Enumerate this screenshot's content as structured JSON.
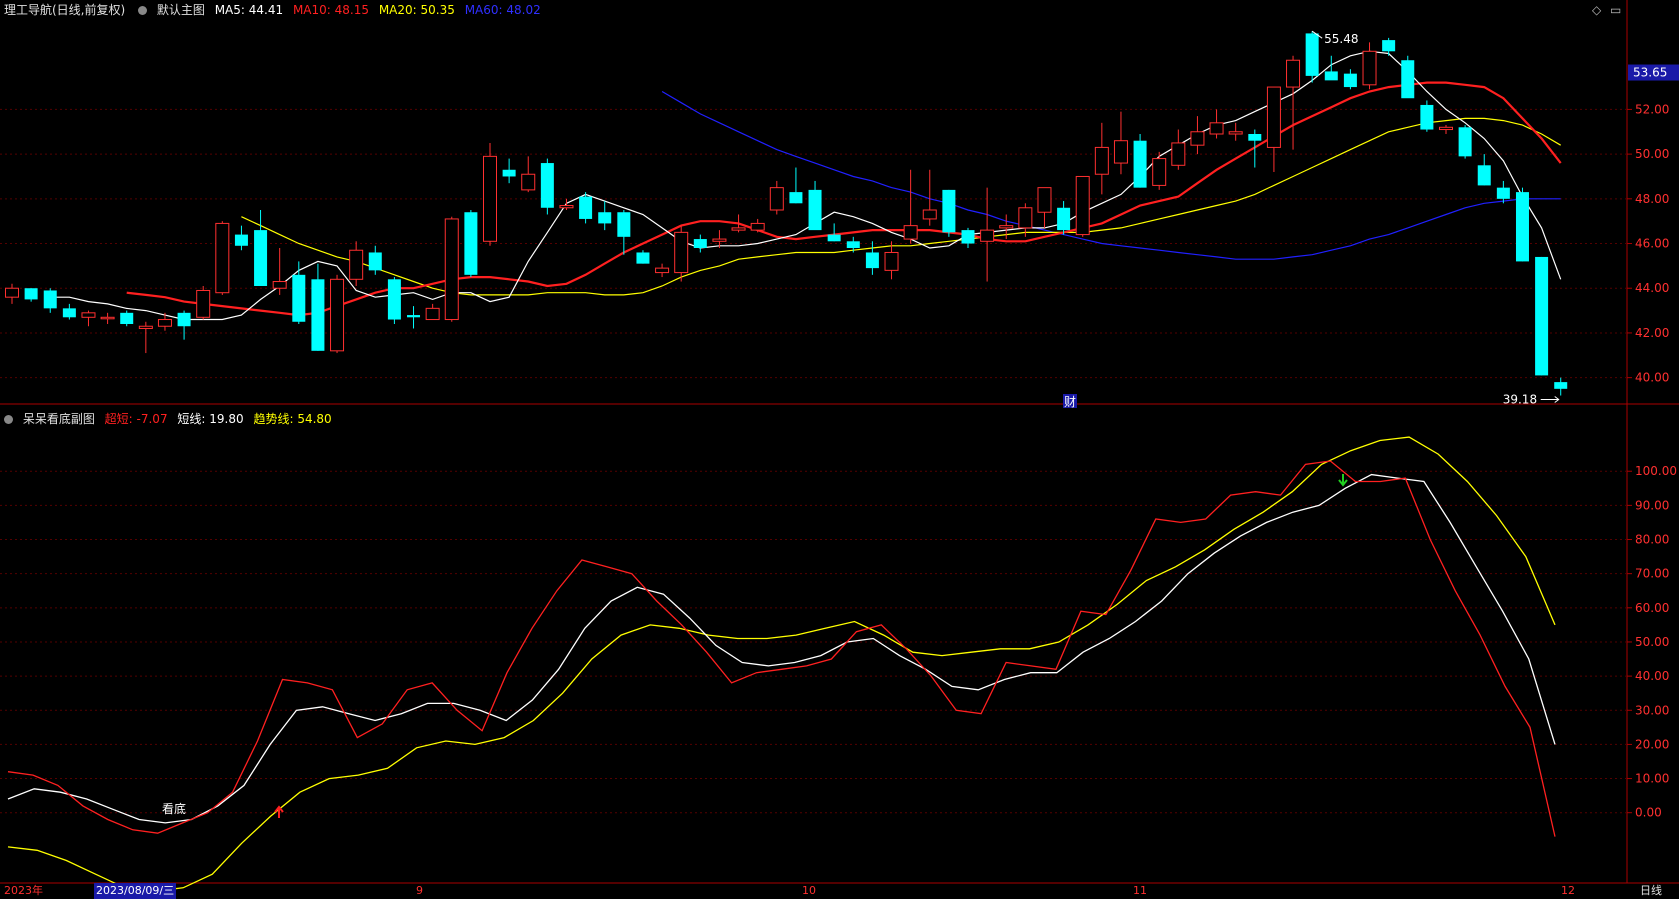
{
  "main_panel": {
    "title": "理工导航(日线,前复权)",
    "selector_label": "默认主图",
    "ma_labels": [
      {
        "text": "MA5: 44.41",
        "color": "#ffffff"
      },
      {
        "text": "MA10: 48.15",
        "color": "#ff2020"
      },
      {
        "text": "MA20: 50.35",
        "color": "#ffff00"
      },
      {
        "text": "MA60: 48.02",
        "color": "#2020ff"
      }
    ],
    "price_ticks": [
      "52.00",
      "50.00",
      "48.00",
      "46.00",
      "44.00",
      "42.00",
      "40.00"
    ],
    "current_price": "53.65",
    "high_marker": "55.48",
    "low_marker": "39.18",
    "finance_marker": "财"
  },
  "sub_panel": {
    "title": "呆呆看底副图",
    "labels": [
      {
        "text": "超短: -7.07",
        "color": "#ff2020"
      },
      {
        "text": "短线: 19.80",
        "color": "#ffffff"
      },
      {
        "text": "趋势线: 54.80",
        "color": "#ffff00"
      }
    ],
    "ticks": [
      "100.00",
      "90.00",
      "80.00",
      "70.00",
      "60.00",
      "50.00",
      "40.00",
      "30.00",
      "20.00",
      "10.00",
      "0.00"
    ],
    "bottom_signal_label": "看底"
  },
  "time_axis": {
    "labels": [
      "2023年",
      "9",
      "10",
      "11",
      "12"
    ],
    "cursor_date": "2023/08/09/三",
    "period_label": "日线"
  },
  "colors": {
    "up": "#ff3030",
    "down": "#00ffff",
    "ma5": "#ffffff",
    "ma10": "#ff2020",
    "ma20": "#ffff00",
    "ma60": "#2020ff",
    "grid": "#550000",
    "frame": "#aa0000"
  },
  "chart_data": [
    {
      "type": "candlestick",
      "title": "理工导航(日线,前复权)",
      "ylim": [
        39,
        56
      ],
      "ohlc": [
        [
          43.6,
          44.2,
          43.3,
          44.0
        ],
        [
          44.0,
          44.0,
          43.4,
          43.5
        ],
        [
          43.9,
          44.0,
          42.9,
          43.1
        ],
        [
          43.1,
          43.3,
          42.6,
          42.7
        ],
        [
          42.7,
          43.0,
          42.3,
          42.9
        ],
        [
          42.7,
          42.9,
          42.4,
          42.7
        ],
        [
          42.9,
          43.0,
          42.3,
          42.4
        ],
        [
          42.2,
          42.5,
          41.1,
          42.3
        ],
        [
          42.3,
          42.9,
          42.1,
          42.6
        ],
        [
          42.9,
          43.0,
          41.7,
          42.3
        ],
        [
          42.7,
          44.1,
          42.6,
          43.9
        ],
        [
          43.8,
          47.0,
          43.7,
          46.9
        ],
        [
          46.4,
          46.8,
          45.7,
          45.9
        ],
        [
          46.6,
          47.5,
          44.1,
          44.1
        ],
        [
          44.0,
          45.8,
          43.7,
          44.3
        ],
        [
          44.6,
          45.2,
          42.4,
          42.5
        ],
        [
          44.4,
          45.1,
          41.2,
          41.2
        ],
        [
          41.2,
          44.6,
          41.1,
          44.4
        ],
        [
          44.4,
          46.1,
          44.1,
          45.7
        ],
        [
          45.6,
          45.9,
          44.6,
          44.8
        ],
        [
          44.4,
          44.5,
          42.4,
          42.6
        ],
        [
          42.8,
          43.2,
          42.2,
          42.7
        ],
        [
          42.6,
          43.3,
          42.6,
          43.1
        ],
        [
          42.6,
          47.2,
          42.5,
          47.1
        ],
        [
          47.4,
          47.5,
          44.5,
          44.6
        ],
        [
          46.1,
          50.5,
          45.9,
          49.9
        ],
        [
          49.3,
          49.8,
          48.7,
          49.0
        ],
        [
          48.4,
          49.9,
          48.3,
          49.1
        ],
        [
          49.6,
          49.8,
          47.3,
          47.6
        ],
        [
          47.6,
          48.0,
          47.5,
          47.7
        ],
        [
          48.1,
          48.3,
          46.9,
          47.1
        ],
        [
          47.4,
          47.9,
          46.6,
          46.9
        ],
        [
          47.4,
          47.5,
          45.5,
          46.3
        ],
        [
          45.6,
          45.7,
          45.1,
          45.1
        ],
        [
          44.7,
          45.1,
          44.5,
          44.9
        ],
        [
          44.7,
          46.8,
          44.3,
          46.5
        ],
        [
          46.2,
          46.4,
          45.6,
          45.8
        ],
        [
          46.1,
          46.6,
          45.8,
          46.2
        ],
        [
          46.6,
          47.3,
          46.5,
          46.7
        ],
        [
          46.6,
          47.1,
          46.5,
          46.9
        ],
        [
          47.5,
          48.8,
          47.3,
          48.5
        ],
        [
          48.3,
          49.4,
          47.8,
          47.8
        ],
        [
          48.4,
          48.8,
          46.9,
          46.6
        ],
        [
          46.4,
          46.9,
          46.1,
          46.1
        ],
        [
          46.1,
          46.3,
          45.6,
          45.8
        ],
        [
          45.6,
          46.1,
          44.6,
          44.9
        ],
        [
          44.8,
          46.1,
          44.4,
          45.6
        ],
        [
          46.2,
          49.3,
          46.0,
          46.8
        ],
        [
          47.1,
          49.3,
          46.8,
          47.5
        ],
        [
          48.4,
          48.4,
          46.3,
          46.5
        ],
        [
          46.6,
          46.7,
          45.8,
          46.0
        ],
        [
          46.1,
          48.5,
          44.3,
          46.6
        ],
        [
          46.7,
          47.3,
          46.2,
          46.8
        ],
        [
          46.7,
          47.8,
          46.3,
          47.6
        ],
        [
          47.4,
          48.5,
          46.7,
          48.5
        ],
        [
          47.6,
          47.9,
          46.4,
          46.6
        ],
        [
          46.4,
          48.9,
          46.3,
          49.0
        ],
        [
          49.1,
          51.4,
          48.2,
          50.3
        ],
        [
          49.6,
          51.9,
          49.1,
          50.6
        ],
        [
          50.6,
          50.9,
          48.5,
          48.5
        ],
        [
          48.6,
          50.1,
          48.4,
          49.8
        ],
        [
          49.5,
          51.1,
          49.3,
          50.5
        ],
        [
          50.4,
          51.7,
          50.0,
          51.0
        ],
        [
          50.9,
          52.0,
          50.7,
          51.4
        ],
        [
          50.9,
          51.4,
          50.6,
          51.0
        ],
        [
          50.9,
          51.1,
          49.4,
          50.6
        ],
        [
          50.3,
          51.8,
          49.2,
          53.0
        ],
        [
          53.0,
          54.4,
          50.2,
          54.2
        ],
        [
          55.4,
          55.5,
          53.2,
          53.5
        ],
        [
          53.7,
          54.4,
          53.4,
          53.3
        ],
        [
          53.6,
          53.8,
          52.9,
          53.0
        ],
        [
          53.1,
          55.0,
          52.9,
          54.6
        ],
        [
          55.1,
          55.2,
          54.4,
          54.6
        ],
        [
          54.2,
          54.4,
          52.6,
          52.5
        ],
        [
          52.2,
          52.4,
          51.0,
          51.1
        ],
        [
          51.1,
          51.3,
          50.9,
          51.2
        ],
        [
          51.2,
          51.3,
          49.8,
          49.9
        ],
        [
          49.5,
          50.0,
          48.6,
          48.6
        ],
        [
          48.5,
          48.8,
          47.8,
          48.0
        ],
        [
          48.3,
          48.5,
          45.2,
          45.2
        ],
        [
          45.4,
          45.4,
          40.1,
          40.1
        ],
        [
          39.8,
          40.0,
          39.2,
          39.5
        ]
      ],
      "ma5": [
        43.6,
        43.6,
        43.4,
        43.3,
        43.1,
        43.0,
        42.8,
        42.6,
        42.6,
        42.6,
        42.8,
        43.5,
        44.1,
        44.8,
        45.2,
        45.0,
        43.9,
        43.6,
        43.7,
        43.8,
        43.5,
        43.8,
        43.8,
        43.4,
        43.6,
        45.2,
        46.5,
        47.8,
        48.2,
        47.9,
        47.6,
        47.3,
        46.7,
        46.1,
        45.8,
        45.9,
        45.9,
        46.0,
        46.2,
        46.4,
        46.9,
        47.4,
        47.2,
        46.9,
        46.5,
        46.2,
        45.8,
        45.9,
        46.4,
        46.5,
        46.6,
        46.7,
        46.7,
        46.9,
        47.4,
        47.8,
        48.2,
        49.0,
        49.9,
        50.4,
        50.9,
        51.3,
        51.5,
        51.9,
        52.3,
        52.7,
        53.3,
        54.0,
        54.4,
        54.6,
        54.5,
        53.7,
        52.8,
        52.0,
        51.4,
        50.7,
        49.7,
        48.1,
        46.7,
        44.4
      ],
      "ma10": [
        43.8,
        43.7,
        43.6,
        43.4,
        43.3,
        43.2,
        43.1,
        43.0,
        42.9,
        42.8,
        42.9,
        43.2,
        43.5,
        43.8,
        44.0,
        44.0,
        44.2,
        44.4,
        44.5,
        44.5,
        44.4,
        44.3,
        44.1,
        44.2,
        44.6,
        45.1,
        45.6,
        46.0,
        46.4,
        46.8,
        47.0,
        47.0,
        46.9,
        46.6,
        46.3,
        46.2,
        46.3,
        46.4,
        46.5,
        46.6,
        46.6,
        46.6,
        46.6,
        46.5,
        46.4,
        46.2,
        46.1,
        46.1,
        46.3,
        46.5,
        46.7,
        46.9,
        47.3,
        47.7,
        47.9,
        48.1,
        48.7,
        49.3,
        49.8,
        50.3,
        50.8,
        51.3,
        51.7,
        52.1,
        52.5,
        52.8,
        53.0,
        53.1,
        53.2,
        53.2,
        53.1,
        53.0,
        52.5,
        51.6,
        50.7,
        49.6
      ],
      "ma20": [
        47.2,
        46.8,
        46.4,
        46.0,
        45.7,
        45.4,
        45.2,
        44.9,
        44.6,
        44.3,
        44.0,
        43.8,
        43.7,
        43.7,
        43.7,
        43.7,
        43.8,
        43.8,
        43.8,
        43.7,
        43.7,
        43.8,
        44.1,
        44.5,
        44.8,
        45.0,
        45.3,
        45.4,
        45.5,
        45.6,
        45.6,
        45.6,
        45.7,
        45.8,
        45.9,
        45.9,
        46.0,
        46.1,
        46.2,
        46.3,
        46.4,
        46.5,
        46.5,
        46.5,
        46.5,
        46.6,
        46.7,
        46.9,
        47.1,
        47.3,
        47.5,
        47.7,
        47.9,
        48.2,
        48.6,
        49.0,
        49.4,
        49.8,
        50.2,
        50.6,
        51.0,
        51.2,
        51.4,
        51.5,
        51.6,
        51.6,
        51.5,
        51.3,
        50.9,
        50.4
      ],
      "ma60": [
        52.8,
        52.3,
        51.8,
        51.4,
        51.0,
        50.6,
        50.2,
        49.9,
        49.6,
        49.3,
        49.0,
        48.8,
        48.5,
        48.3,
        48.0,
        47.8,
        47.5,
        47.3,
        47.0,
        46.8,
        46.6,
        46.4,
        46.2,
        46.0,
        45.9,
        45.8,
        45.7,
        45.6,
        45.5,
        45.4,
        45.3,
        45.3,
        45.3,
        45.4,
        45.5,
        45.7,
        45.9,
        46.2,
        46.4,
        46.7,
        47.0,
        47.3,
        47.6,
        47.8,
        47.9,
        48.0,
        48.0,
        48.0
      ]
    },
    {
      "type": "line",
      "title": "呆呆看底副图",
      "ylim": [
        -20,
        115
      ],
      "series": [
        {
          "name": "超短",
          "values": [
            12,
            11,
            8,
            2,
            -2,
            -5,
            -6,
            -3,
            0,
            6,
            21,
            39,
            38,
            36,
            22,
            26,
            36,
            38,
            30,
            24,
            41,
            54,
            65,
            74,
            72,
            70,
            62,
            55,
            47,
            38,
            41,
            42,
            43,
            45,
            53,
            55,
            48,
            40,
            30,
            29,
            44,
            43,
            42,
            59,
            58,
            71,
            86,
            85,
            86,
            93,
            94,
            93,
            102,
            103,
            97,
            97,
            98,
            80,
            65,
            52,
            37,
            25,
            -7
          ]
        },
        {
          "name": "短线",
          "values": [
            4,
            7,
            6,
            4,
            1,
            -2,
            -3,
            -2,
            2,
            8,
            20,
            30,
            31,
            29,
            27,
            29,
            32,
            32,
            30,
            27,
            33,
            42,
            54,
            62,
            66,
            64,
            57,
            49,
            44,
            43,
            44,
            46,
            50,
            51,
            46,
            42,
            37,
            36,
            39,
            41,
            41,
            47,
            51,
            56,
            62,
            70,
            76,
            81,
            85,
            88,
            90,
            95,
            99,
            98,
            97,
            85,
            72,
            59,
            45,
            20
          ]
        },
        {
          "name": "趋势线",
          "values": [
            -10,
            -11,
            -14,
            -18,
            -22,
            -23,
            -22,
            -18,
            -9,
            -1,
            6,
            10,
            11,
            13,
            19,
            21,
            20,
            22,
            27,
            35,
            45,
            52,
            55,
            54,
            52,
            51,
            51,
            52,
            54,
            56,
            52,
            47,
            46,
            47,
            48,
            48,
            50,
            55,
            61,
            68,
            72,
            77,
            83,
            88,
            94,
            102,
            106,
            109,
            110,
            105,
            97,
            87,
            75,
            55
          ]
        }
      ]
    }
  ]
}
